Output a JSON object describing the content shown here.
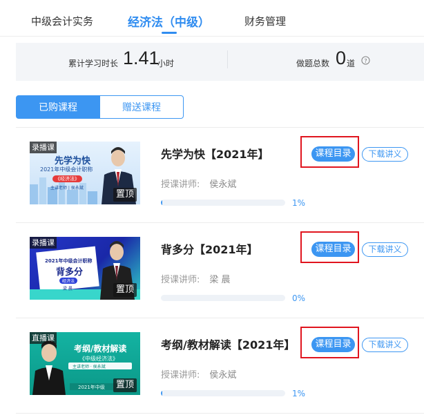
{
  "subjects": {
    "tabs": [
      {
        "label": "中级会计实务"
      },
      {
        "label": "经济法（中级）"
      },
      {
        "label": "财务管理"
      }
    ]
  },
  "stats": {
    "study_label": "累计学习时长",
    "study_value": "1.41",
    "study_unit": "小时",
    "questions_label": "做题总数",
    "questions_value": "0",
    "questions_unit": "道"
  },
  "course_tabs": {
    "purchased": "已购课程",
    "gifted": "赠送课程"
  },
  "courses": [
    {
      "title": "先学为快【2021年】",
      "teacher_label": "授课讲师:",
      "teacher": "侯永斌",
      "progress": 1,
      "progress_text": "1%",
      "tag": "录播课",
      "pin": "置顶",
      "thumb_lines": [
        "先学为快",
        "2021年中级会计职称",
        "《经济法》",
        "主讲老师 | 侯永斌"
      ],
      "catalog_label": "课程目录",
      "download_label": "下载讲义"
    },
    {
      "title": "背多分【2021年】",
      "teacher_label": "授课讲师:",
      "teacher": "梁 晨",
      "progress": 0,
      "progress_text": "0%",
      "tag": "录播课",
      "pin": "置顶",
      "thumb_lines": [
        "2021年中级会计职称",
        "背多分",
        "经济法",
        "梁 晨"
      ],
      "catalog_label": "课程目录",
      "download_label": "下载讲义"
    },
    {
      "title": "考纲/教材解读【2021年】",
      "teacher_label": "授课讲师:",
      "teacher": "侯永斌",
      "progress": 1,
      "progress_text": "1%",
      "tag": "直播课",
      "pin": "置顶",
      "thumb_lines": [
        "考纲/教材解读",
        "《中级经济法》",
        "主讲老师 · 侯永斌",
        "2021年中级"
      ],
      "catalog_label": "课程目录",
      "download_label": "下载讲义"
    }
  ],
  "colors": {
    "accent": "#3c96f2",
    "highlight": "#e0141e",
    "thumb1_bg": "#d6e9fb",
    "thumb2_bg": "#1f2fb8",
    "thumb3_bg": "#0fa99a"
  }
}
